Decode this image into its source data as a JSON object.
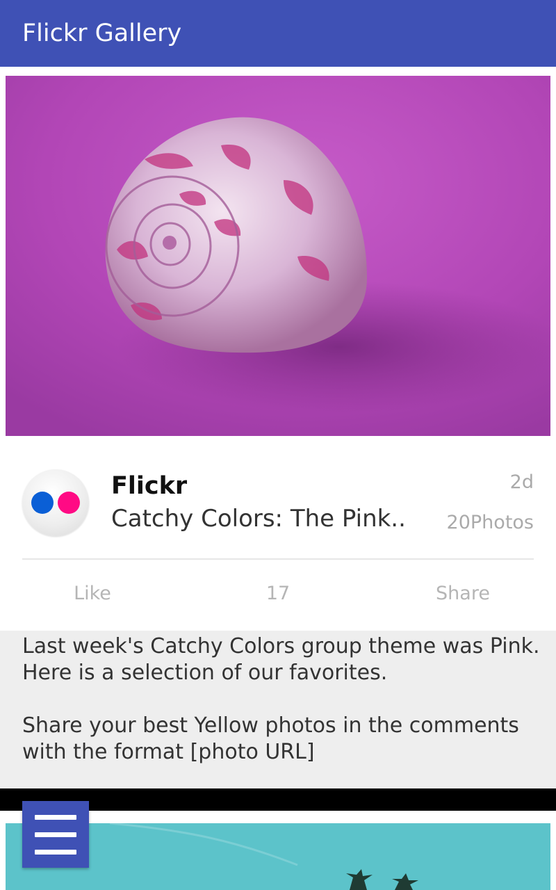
{
  "app_bar": {
    "title": "Flickr Gallery"
  },
  "post": {
    "photo_subject": "pink seashell on magenta background",
    "avatar_icon": "flickr-logo-icon",
    "author": "Flickr",
    "title": "Catchy Colors: The Pink..",
    "age": "2d",
    "photo_count": "20Photos",
    "actions": {
      "like_label": "Like",
      "like_count": "17",
      "share_label": "Share"
    },
    "description": {
      "line1": "Last week's Catchy Colors group theme was Pink.",
      "line2": "Here is a selection of our favorites.",
      "line3": "Share your best Yellow photos in the comments",
      "line4": "with the format [photo URL]"
    }
  },
  "next_post": {
    "photo_subject": "teal sky with palm trees"
  },
  "menu_button": {
    "icon": "hamburger-menu-icon"
  },
  "colors": {
    "primary": "#3F51B5",
    "flickr_blue": "#0a5fd6",
    "flickr_pink": "#ff0a84",
    "description_bg": "#eeeeee",
    "muted_text": "#aaaaaa"
  }
}
